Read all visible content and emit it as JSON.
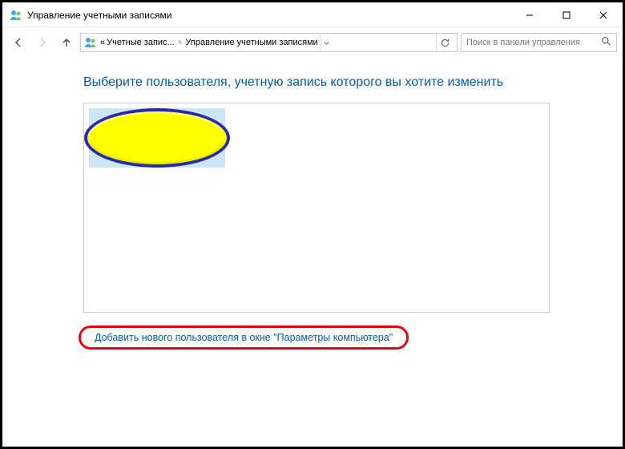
{
  "titlebar": {
    "title": "Управление учетными записями"
  },
  "breadcrumb": {
    "prefix": "«",
    "item1": "Учетные запис...",
    "item2": "Управление учетными записями"
  },
  "search": {
    "placeholder": "Поиск в панели управления"
  },
  "content": {
    "heading": "Выберите пользователя, учетную запись которого вы хотите изменить",
    "add_user_link": "Добавить нового пользователя в окне \"Параметры компьютера\""
  }
}
